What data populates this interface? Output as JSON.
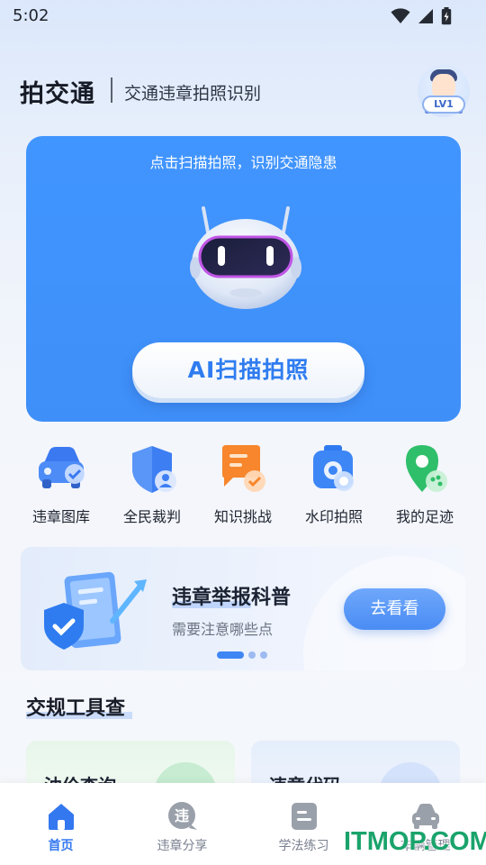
{
  "status_bar": {
    "time": "5:02"
  },
  "header": {
    "app_title": "拍交通",
    "app_subtitle": "交通违章拍照识别",
    "level_badge": "LV1"
  },
  "scan_card": {
    "hint": "点击扫描拍照，识别交通隐患",
    "button_label": "AI扫描拍照"
  },
  "shortcuts": [
    {
      "label": "违章图库",
      "icon": "car-gallery-icon"
    },
    {
      "label": "全民裁判",
      "icon": "shield-user-icon"
    },
    {
      "label": "知识挑战",
      "icon": "chat-check-icon"
    },
    {
      "label": "水印拍照",
      "icon": "camera-icon"
    },
    {
      "label": "我的足迹",
      "icon": "location-pin-icon"
    }
  ],
  "banner": {
    "title": "违章举报科普",
    "subtitle": "需要注意哪些点",
    "button_label": "去看看",
    "page_count": 3,
    "active_page": 1
  },
  "section": {
    "title": "交规工具查",
    "tools": [
      {
        "label": "油价查询"
      },
      {
        "label": "违章代码"
      }
    ]
  },
  "bottom_nav": [
    {
      "label": "首页",
      "icon": "home-icon",
      "active": true
    },
    {
      "label": "违章分享",
      "icon": "share-chat-icon",
      "active": false
    },
    {
      "label": "学法练习",
      "icon": "book-icon",
      "active": false
    },
    {
      "label": "车辆管理",
      "icon": "car-icon",
      "active": false
    }
  ],
  "watermark": "ITMOP.COM",
  "colors": {
    "primary": "#3f8ff8",
    "accent_blue": "#3478f0",
    "watermark_green": "#1aa36b"
  }
}
